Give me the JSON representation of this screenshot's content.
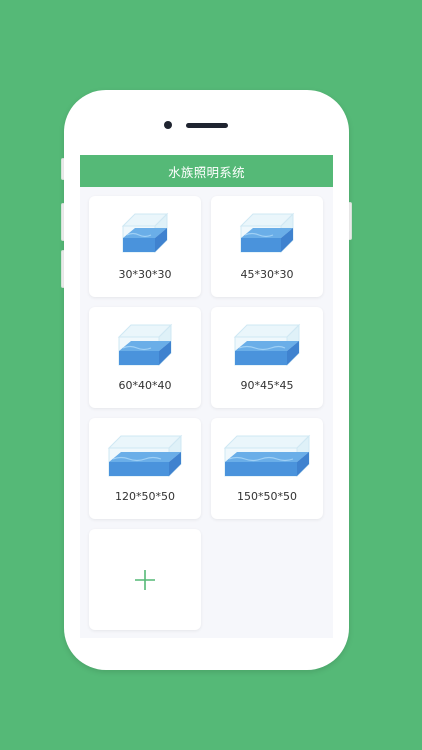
{
  "app": {
    "title": "水族照明系统"
  },
  "colors": {
    "background": "#55b977",
    "header": "#55b977",
    "plus": "#55b977"
  },
  "tanks": [
    {
      "label": "30*30*30",
      "icon": "aquarium-icon"
    },
    {
      "label": "45*30*30",
      "icon": "aquarium-icon"
    },
    {
      "label": "60*40*40",
      "icon": "aquarium-icon"
    },
    {
      "label": "90*45*45",
      "icon": "aquarium-icon"
    },
    {
      "label": "120*50*50",
      "icon": "aquarium-icon"
    },
    {
      "label": "150*50*50",
      "icon": "aquarium-icon"
    }
  ],
  "add_button": {
    "icon": "plus-icon"
  }
}
